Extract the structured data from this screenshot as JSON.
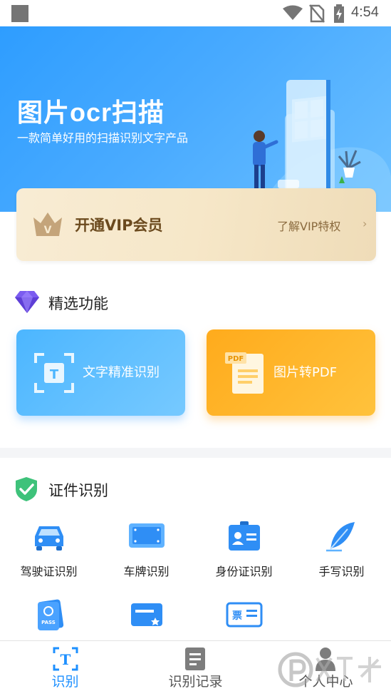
{
  "status_bar": {
    "time": "4:54"
  },
  "hero": {
    "title": "图片ocr扫描",
    "subtitle": "一款简单好用的扫描识别文字产品"
  },
  "vip": {
    "crown_letter": "V",
    "title": "开通VIP会员",
    "link": "了解VIP特权",
    "chevron": "›"
  },
  "featured": {
    "title": "精选功能",
    "cards": [
      {
        "label": "文字精准识别",
        "icon": "text-scan-icon"
      },
      {
        "label": "图片转PDF",
        "icon": "pdf-document-icon",
        "badge": "PDF"
      }
    ]
  },
  "id_section": {
    "title": "证件识别",
    "items": [
      {
        "label": "驾驶证识别",
        "icon": "car-icon"
      },
      {
        "label": "车牌识别",
        "icon": "license-plate-icon"
      },
      {
        "label": "身份证识别",
        "icon": "id-card-icon"
      },
      {
        "label": "手写识别",
        "icon": "feather-icon"
      },
      {
        "label": "",
        "icon": "passport-icon",
        "badge": "PASS"
      },
      {
        "label": "",
        "icon": "bank-card-icon"
      },
      {
        "label": "",
        "icon": "invoice-icon",
        "badge": "票"
      }
    ]
  },
  "bottom_nav": {
    "items": [
      {
        "label": "识别",
        "icon": "text-recognize-icon",
        "active": true,
        "glyph": "T"
      },
      {
        "label": "识别记录",
        "icon": "record-icon",
        "active": false
      },
      {
        "label": "个人中心",
        "icon": "person-icon",
        "active": false
      }
    ]
  },
  "colors": {
    "primary": "#2e9dff",
    "vip_text": "#6b4a1e",
    "orange": "#ffab1c",
    "active_nav": "#1e90ff",
    "inactive_nav": "#555555"
  }
}
